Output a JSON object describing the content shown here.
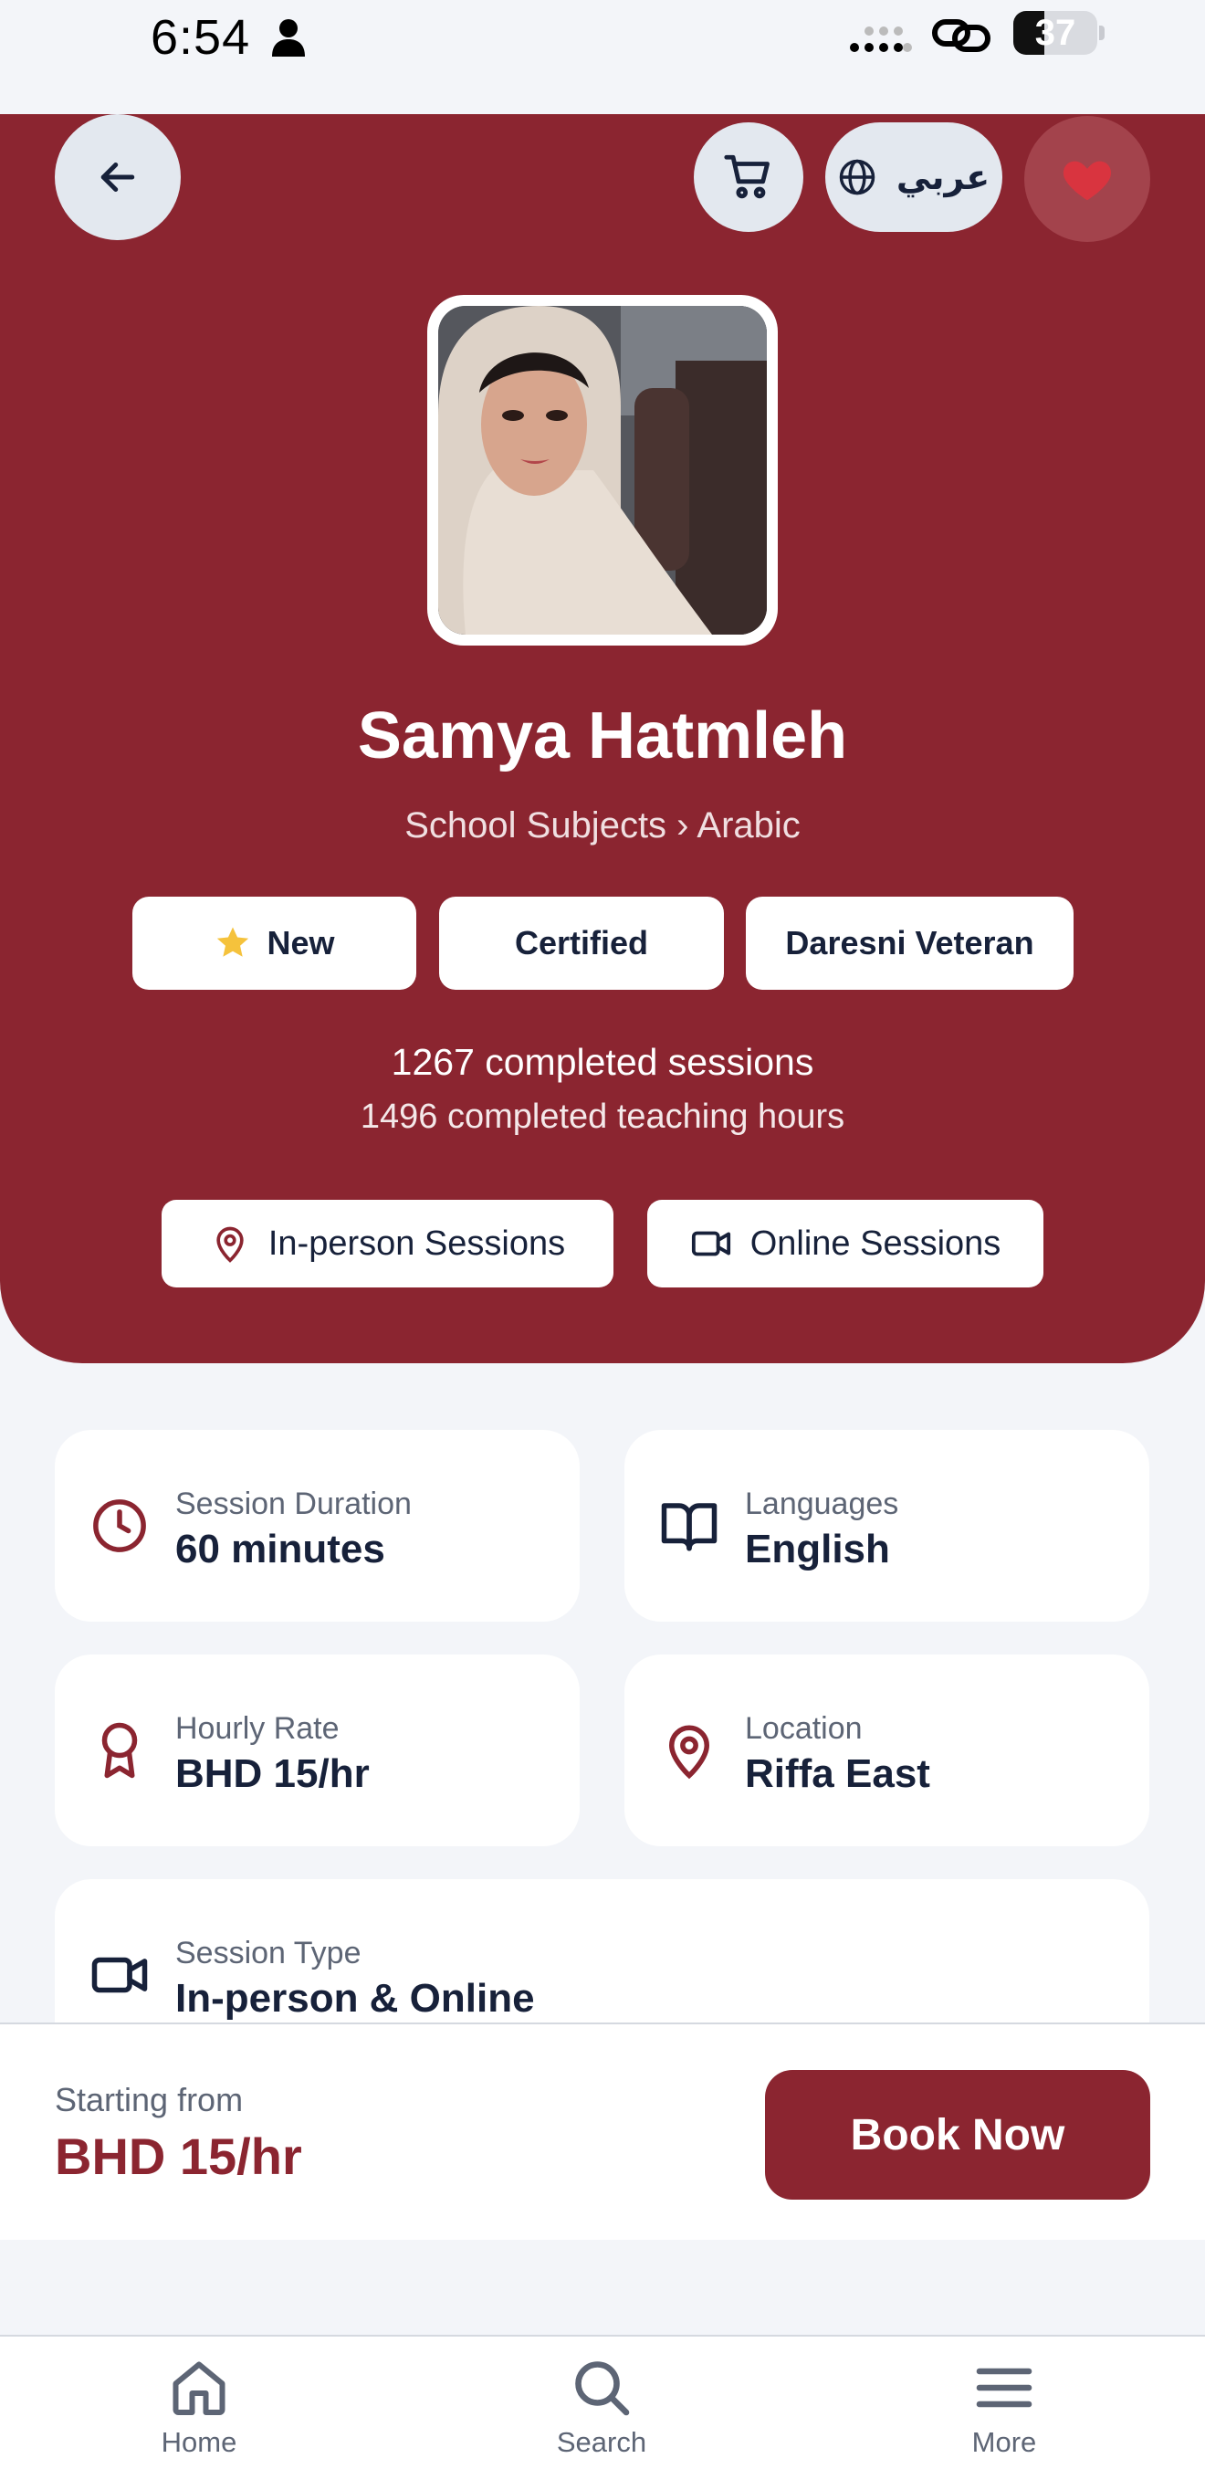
{
  "status_bar": {
    "time": "6:54",
    "battery": "37"
  },
  "header": {
    "language_label": "عربي"
  },
  "profile": {
    "name": "Samya Hatmleh",
    "subject_path": "School Subjects › Arabic",
    "badges": [
      "New",
      "Certified",
      "Daresni Veteran"
    ],
    "completed_sessions": "1267 completed sessions",
    "completed_hours": "1496 completed teaching hours",
    "session_modes": [
      "In-person Sessions",
      "Online Sessions"
    ]
  },
  "details": {
    "duration": {
      "label": "Session Duration",
      "value": "60 minutes",
      "icon": "clock-icon"
    },
    "languages": {
      "label": "Languages",
      "value": "English",
      "icon": "book-icon"
    },
    "rate": {
      "label": "Hourly Rate",
      "value": "BHD 15/hr",
      "icon": "award-icon"
    },
    "location": {
      "label": "Location",
      "value": "Riffa East",
      "icon": "map-pin-icon"
    },
    "session_type": {
      "label": "Session Type",
      "value": "In-person & Online",
      "icon": "video-icon"
    }
  },
  "booking": {
    "starting_label": "Starting from",
    "price": "BHD 15/hr",
    "button_label": "Book Now"
  },
  "tabs": [
    {
      "label": "Home",
      "icon": "home-icon"
    },
    {
      "label": "Search",
      "icon": "search-icon"
    },
    {
      "label": "More",
      "icon": "menu-icon"
    }
  ],
  "colors": {
    "brand": "#8b2530",
    "background": "#f3f5f9",
    "text_dark": "#17213a",
    "star": "#f5c23c",
    "heart": "#d9343f"
  }
}
